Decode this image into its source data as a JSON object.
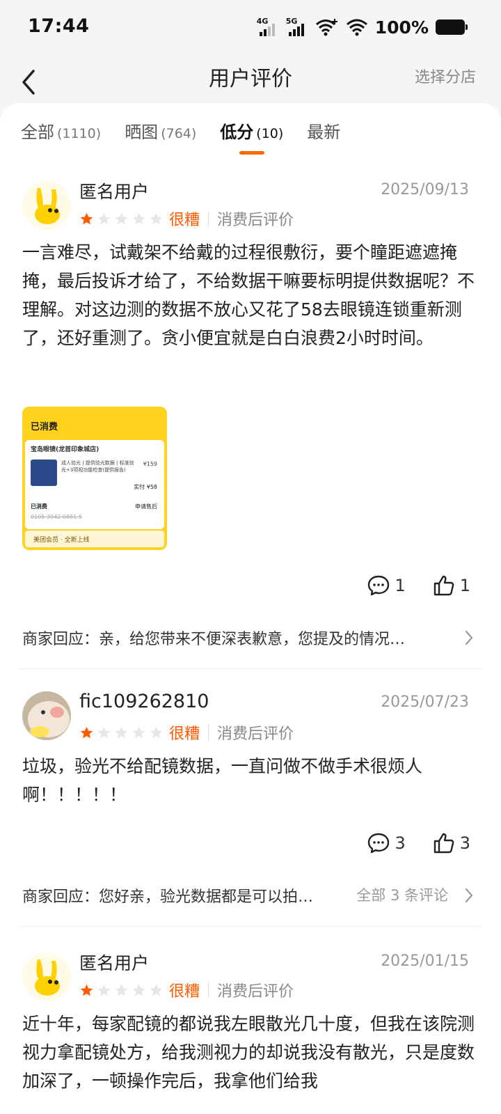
{
  "status_bar": {
    "time": "17:44",
    "net1": "4G",
    "net2": "5G",
    "battery": "100%"
  },
  "header": {
    "title": "用户评价",
    "branch": "选择分店"
  },
  "tabs": [
    {
      "label": "全部",
      "count": "(1110)"
    },
    {
      "label": "晒图",
      "count": "(764)"
    },
    {
      "label": "低分",
      "count": "(10)"
    },
    {
      "label": "最新",
      "count": ""
    }
  ],
  "active_tab": "低分",
  "colors": {
    "accent": "#ff6a00",
    "star_filled": "#ff5a00",
    "star_empty": "#e6e6e6"
  },
  "reviews": [
    {
      "user": "匿名用户",
      "date": "2025/09/13",
      "stars": 1,
      "rating_word": "很糟",
      "tag": "消费后评价",
      "text": "一言难尽，试戴架不给戴的过程很敷衍，要个瞳距遮遮掩掩，最后投诉才给了，不给数据干嘛要标明提供数据呢？不理解。对这边测的数据不放心又花了58去眼镜连锁重新测了，还好重测了。贪小便宜就是白白浪费2小时时间。",
      "image": {
        "status": "已消费",
        "shop": "宝岛眼镜(龙首印象城店)",
        "product": "成人验光 | 提供验光数据 | 标准验光+3项视功能检查(提供报告)",
        "price": "¥159",
        "paid": "实付 ¥58",
        "used": "已消费",
        "code": "0105 3942 0881 5",
        "after_sale": "申请售后",
        "footer": "美团会员 · 全新上线"
      },
      "comments": "1",
      "likes": "1",
      "merchant_reply": "商家回应：亲，给您带来不便深表歉意，您提及的情况…",
      "merchant_all": ""
    },
    {
      "user": "fic109262810",
      "date": "2025/07/23",
      "stars": 1,
      "rating_word": "很糟",
      "tag": "消费后评价",
      "text": "垃圾，验光不给配镜数据，一直问做不做手术很烦人啊！！！！！",
      "comments": "3",
      "likes": "3",
      "merchant_reply": "商家回应：您好亲，验光数据都是可以拍…",
      "merchant_all": "全部 3 条评论"
    },
    {
      "user": "匿名用户",
      "date": "2025/01/15",
      "stars": 1,
      "rating_word": "很糟",
      "tag": "消费后评价",
      "text": "近十年，每家配镜的都说我左眼散光几十度，但我在该院测视力拿配镜处方，给我测视力的却说我没有散光，只是度数加深了，一顿操作完后，我拿他们给我"
    }
  ]
}
